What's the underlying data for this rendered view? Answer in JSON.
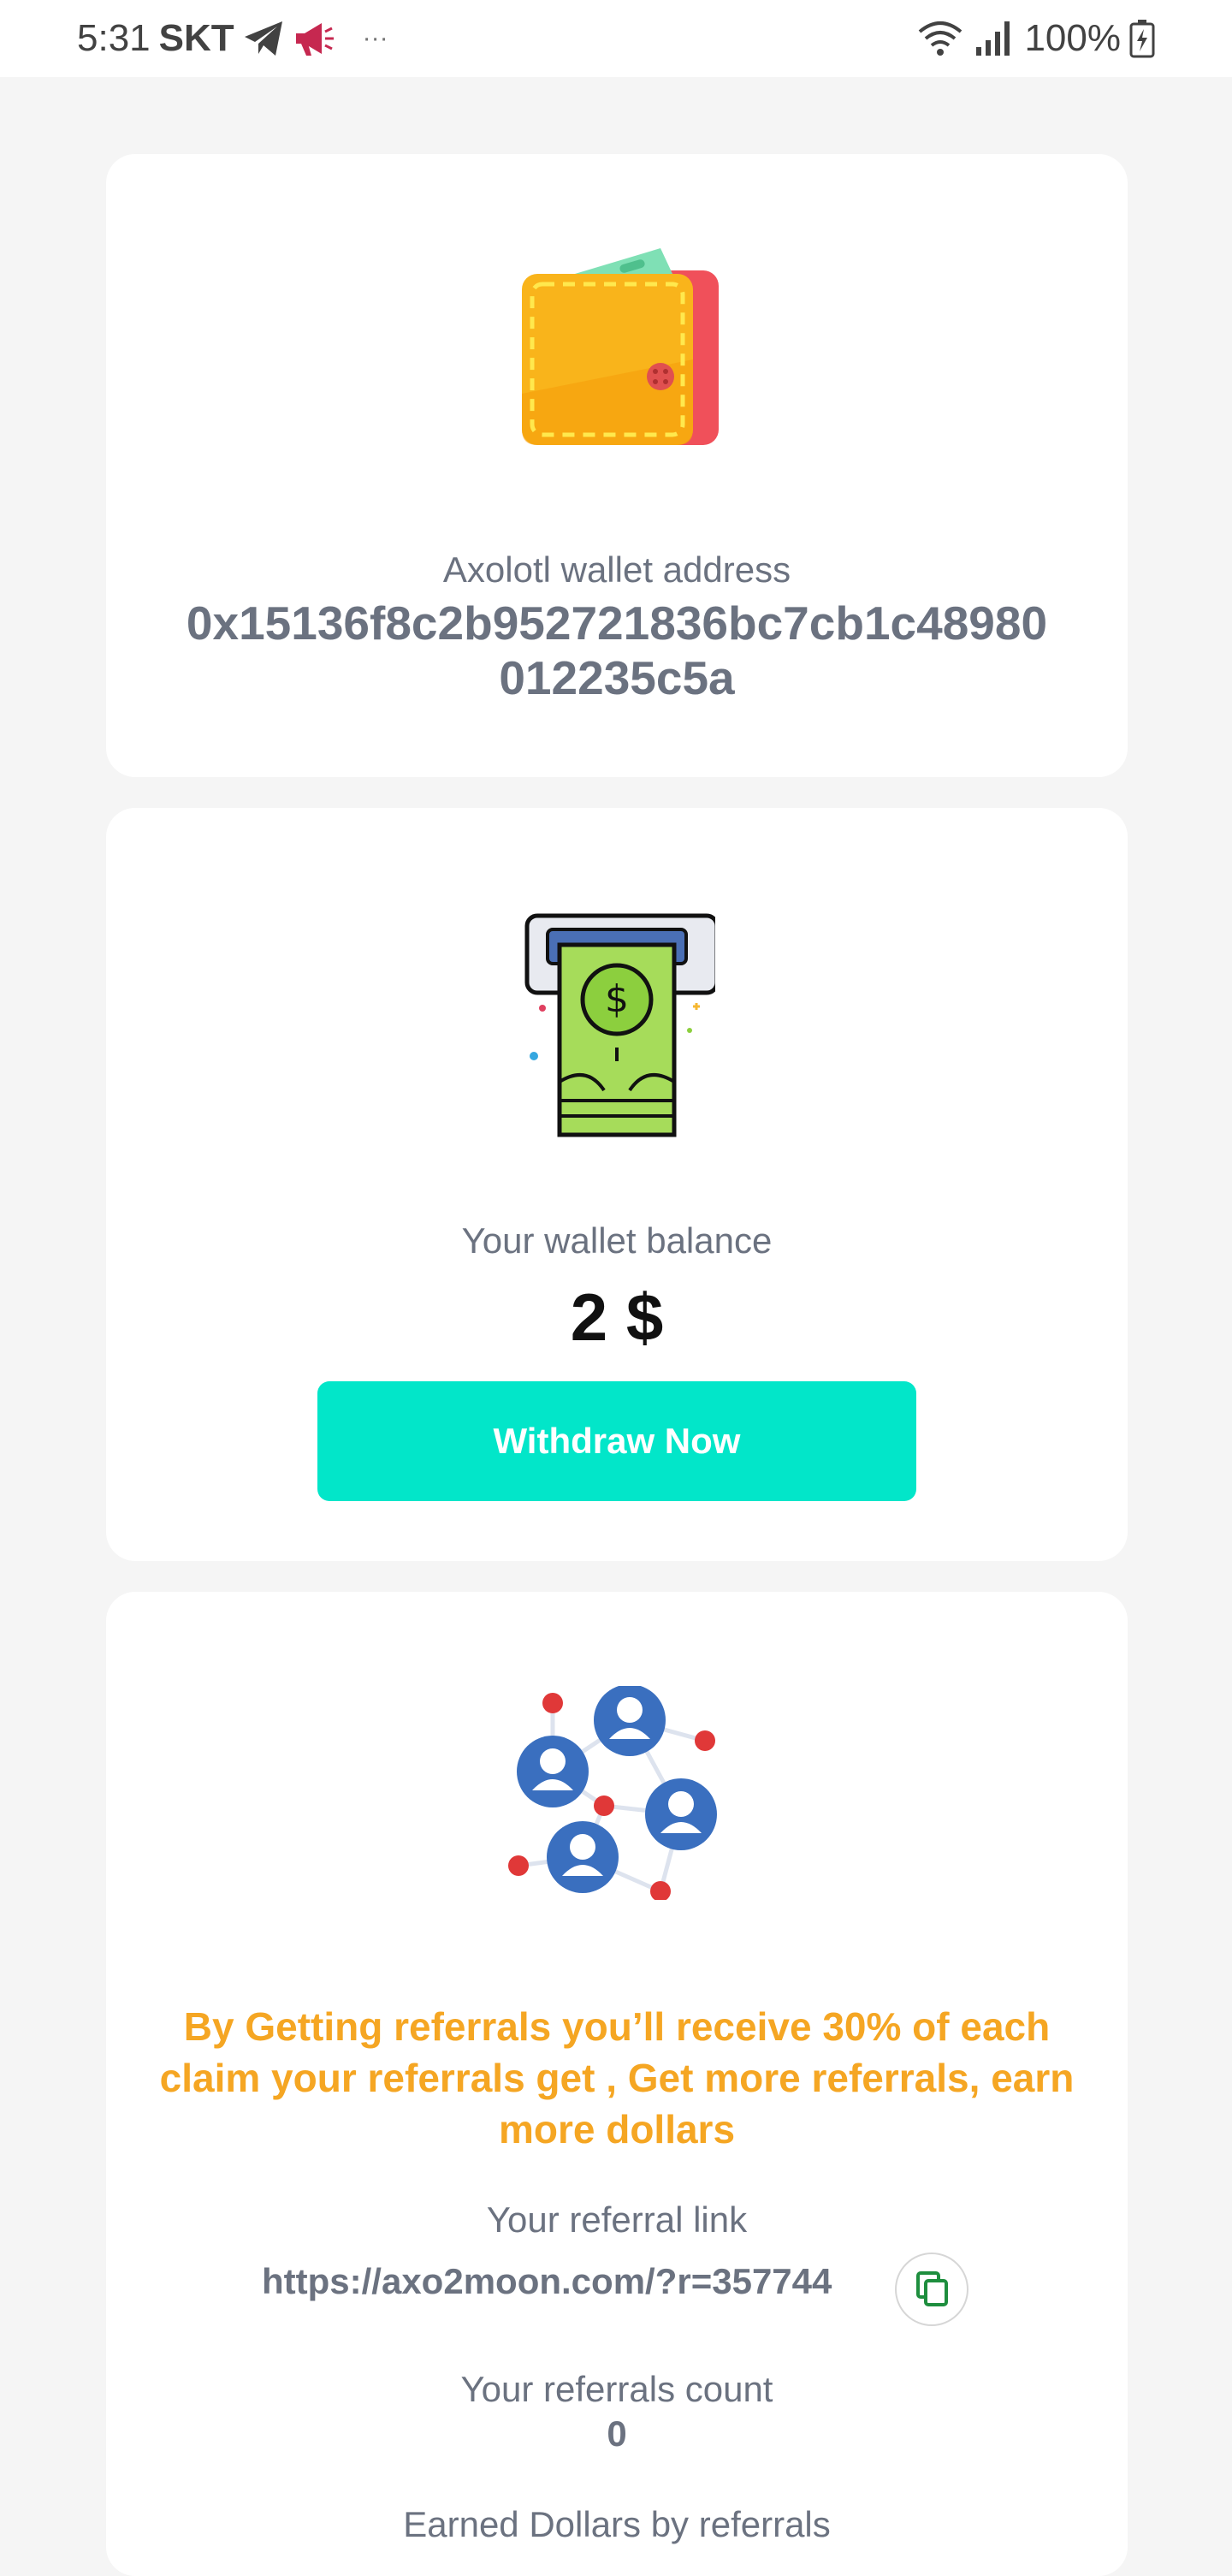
{
  "status_bar": {
    "time": "5:31",
    "carrier": "SKT",
    "more": "···",
    "battery": "100%"
  },
  "wallet_card": {
    "label": "Axolotl wallet address",
    "address": "0x15136f8c2b952721836bc7cb1c48980012235c5a"
  },
  "balance_card": {
    "label": "Your wallet balance",
    "value": "2 $",
    "withdraw_label": "Withdraw Now"
  },
  "referral_card": {
    "promo": "By Getting referrals you’ll receive 30% of each claim your referrals get , Get more referrals, earn more dollars",
    "link_label": "Your referral link",
    "link": "https://axo2moon.com/?r=357744",
    "count_label": "Your referrals count",
    "count": "0",
    "earned_label": "Earned Dollars by referrals"
  },
  "colors": {
    "accent": "#02e6c9",
    "promo": "#f5a623",
    "muted_text": "#6b7280",
    "background": "#f5f5f5"
  },
  "icons": {
    "wallet": "wallet-icon",
    "atm_cash": "atm-cash-icon",
    "network": "referral-network-icon",
    "copy": "copy-icon"
  }
}
